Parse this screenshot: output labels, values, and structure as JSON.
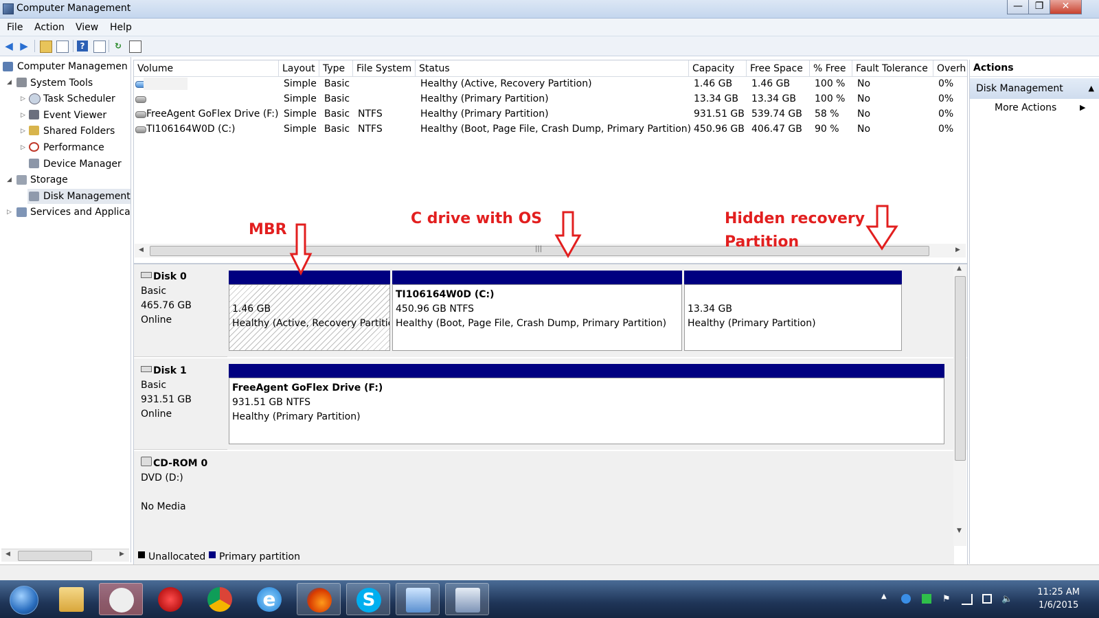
{
  "window": {
    "title": "Computer Management"
  },
  "menu": [
    "File",
    "Action",
    "View",
    "Help"
  ],
  "toolbar": {
    "icons": [
      "back-icon",
      "forward-icon",
      "up-folder-icon",
      "show-hide-tree-icon",
      "help-icon",
      "properties-icon",
      "refresh-icon",
      "export-icon"
    ]
  },
  "tree": {
    "root": "Computer Managemen",
    "items": [
      {
        "label": "System Tools"
      },
      {
        "label": "Task Scheduler"
      },
      {
        "label": "Event Viewer"
      },
      {
        "label": "Shared Folders"
      },
      {
        "label": "Performance"
      },
      {
        "label": "Device Manager"
      },
      {
        "label": "Storage"
      },
      {
        "label": "Disk Management"
      },
      {
        "label": "Services and Applica"
      }
    ]
  },
  "volumes": {
    "headers": [
      "Volume",
      "Layout",
      "Type",
      "File System",
      "Status",
      "Capacity",
      "Free Space",
      "% Free",
      "Fault Tolerance",
      "Overh"
    ],
    "rows": [
      {
        "volume": "",
        "layout": "Simple",
        "type": "Basic",
        "fs": "",
        "status": "Healthy (Active, Recovery Partition)",
        "capacity": "1.46 GB",
        "free": "1.46 GB",
        "pct": "100 %",
        "fault": "No",
        "overhead": "0%"
      },
      {
        "volume": "",
        "layout": "Simple",
        "type": "Basic",
        "fs": "",
        "status": "Healthy (Primary Partition)",
        "capacity": "13.34 GB",
        "free": "13.34 GB",
        "pct": "100 %",
        "fault": "No",
        "overhead": "0%"
      },
      {
        "volume": "FreeAgent GoFlex Drive (F:)",
        "layout": "Simple",
        "type": "Basic",
        "fs": "NTFS",
        "status": "Healthy (Primary Partition)",
        "capacity": "931.51 GB",
        "free": "539.74 GB",
        "pct": "58 %",
        "fault": "No",
        "overhead": "0%"
      },
      {
        "volume": "TI106164W0D (C:)",
        "layout": "Simple",
        "type": "Basic",
        "fs": "NTFS",
        "status": "Healthy (Boot, Page File, Crash Dump, Primary Partition)",
        "capacity": "450.96 GB",
        "free": "406.47 GB",
        "pct": "90 %",
        "fault": "No",
        "overhead": "0%"
      }
    ]
  },
  "annotations": {
    "mbr": "MBR",
    "cdrive": "C drive with OS",
    "recovery_line1": "Hidden recovery",
    "recovery_line2": "Partition",
    "color": "#e21f1f"
  },
  "disks": [
    {
      "name": "Disk 0",
      "type": "Basic",
      "size": "465.76 GB",
      "state": "Online",
      "partitions": [
        {
          "name": "",
          "size": "1.46 GB",
          "status": "Healthy (Active, Recovery Partitic"
        },
        {
          "name": "TI106164W0D  (C:)",
          "size": "450.96 GB NTFS",
          "status": "Healthy (Boot, Page File, Crash Dump, Primary Partition)"
        },
        {
          "name": "",
          "size": "13.34 GB",
          "status": "Healthy (Primary Partition)"
        }
      ]
    },
    {
      "name": "Disk 1",
      "type": "Basic",
      "size": "931.51 GB",
      "state": "Online",
      "partitions": [
        {
          "name": "FreeAgent GoFlex Drive  (F:)",
          "size": "931.51 GB NTFS",
          "status": "Healthy (Primary Partition)"
        }
      ]
    },
    {
      "name": "CD-ROM 0",
      "type": "DVD (D:)",
      "state": "No Media"
    }
  ],
  "legend": {
    "unallocated": "Unallocated",
    "primary": "Primary partition",
    "colors": {
      "unallocated": "#000000",
      "primary": "#000080"
    }
  },
  "actions": {
    "header": "Actions",
    "section": "Disk Management",
    "items": [
      "More Actions"
    ]
  },
  "taskbar": {
    "apps": [
      "windows-start-icon",
      "file-explorer-icon",
      "snipping-tool-icon",
      "pokerstars-icon",
      "chrome-icon",
      "internet-explorer-icon",
      "firefox-icon",
      "skype-icon",
      "remote-desktop-icon",
      "computer-management-icon"
    ],
    "time": "11:25 AM",
    "date": "1/6/2015"
  }
}
